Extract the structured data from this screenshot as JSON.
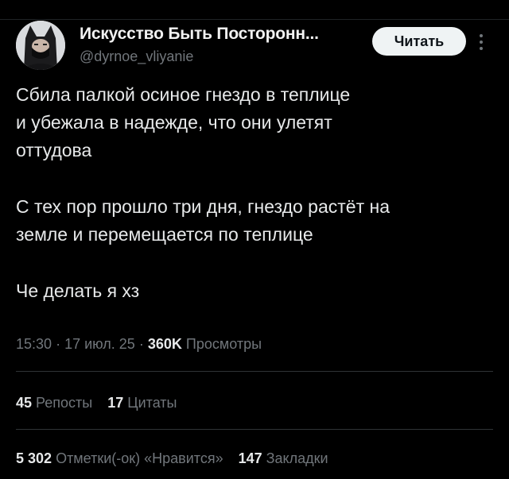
{
  "author": {
    "display_name": "Искусство Быть Посторонн...",
    "handle": "@dyrnoe_vliyanie"
  },
  "follow_button_label": "Читать",
  "tweet": {
    "paragraphs": [
      "Сбила палкой осиное гнездо в теплице\nи убежала в надежде, что они улетят\nоттудова",
      "С тех пор прошло три дня, гнездо растёт на\nземле и перемещается по теплице",
      "Че делать я хз"
    ]
  },
  "meta": {
    "time": "15:30",
    "separator": "·",
    "date": "17 июл. 25",
    "views_count": "360K",
    "views_label": "Просмотры"
  },
  "stats_row1": [
    {
      "count": "45",
      "label": "Репосты"
    },
    {
      "count": "17",
      "label": "Цитаты"
    }
  ],
  "stats_row2": [
    {
      "count": "5 302",
      "label": "Отметки(-ок) «Нравится»"
    },
    {
      "count": "147",
      "label": "Закладки"
    }
  ],
  "colors": {
    "background": "#000000",
    "text_primary": "#e7e9ea",
    "text_secondary": "#71767b",
    "divider": "#2f3336",
    "button_bg": "#eff3f4"
  }
}
